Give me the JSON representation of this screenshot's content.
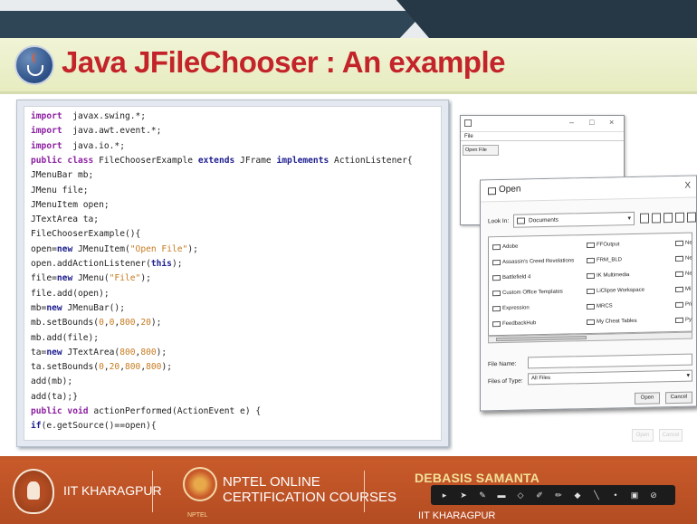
{
  "slide": {
    "title_part1": "Java JFileChooser",
    "title_part2": " : An example"
  },
  "code_lines": [
    [
      [
        "kw",
        "import"
      ],
      [
        "",
        "  javax.swing.*;"
      ]
    ],
    [
      [
        "kw",
        "import"
      ],
      [
        "",
        "  java.awt.event.*;"
      ]
    ],
    [
      [
        "kw",
        "import"
      ],
      [
        "",
        "  java.io.*;"
      ]
    ],
    [
      [
        "kw",
        "public class"
      ],
      [
        "",
        " FileChooserExample "
      ],
      [
        "kwb",
        "extends"
      ],
      [
        "",
        " JFrame "
      ],
      [
        "kwb",
        "implements"
      ],
      [
        "",
        " ActionListener{"
      ]
    ],
    [
      [
        "",
        "JMenuBar mb;"
      ]
    ],
    [
      [
        "",
        "JMenu file;"
      ]
    ],
    [
      [
        "",
        "JMenuItem open;"
      ]
    ],
    [
      [
        "",
        "JTextArea ta;"
      ]
    ],
    [
      [
        "",
        "FileChooserExample(){"
      ]
    ],
    [
      [
        "",
        "open="
      ],
      [
        "kwb",
        "new"
      ],
      [
        "",
        " JMenuItem("
      ],
      [
        "str",
        "\"Open File\""
      ],
      [
        "",
        ");"
      ]
    ],
    [
      [
        "",
        "open.addActionListener("
      ],
      [
        "kwb",
        "this"
      ],
      [
        "",
        ");"
      ]
    ],
    [
      [
        "",
        "file="
      ],
      [
        "kwb",
        "new"
      ],
      [
        "",
        " JMenu("
      ],
      [
        "str",
        "\"File\""
      ],
      [
        "",
        ");"
      ]
    ],
    [
      [
        "",
        "file.add(open);"
      ]
    ],
    [
      [
        "",
        "mb="
      ],
      [
        "kwb",
        "new"
      ],
      [
        "",
        " JMenuBar();"
      ]
    ],
    [
      [
        "",
        "mb.setBounds("
      ],
      [
        "num",
        "0"
      ],
      [
        "",
        ","
      ],
      [
        "num",
        "0"
      ],
      [
        "",
        ","
      ],
      [
        "num",
        "800"
      ],
      [
        "",
        ","
      ],
      [
        "num",
        "20"
      ],
      [
        "",
        ");"
      ]
    ],
    [
      [
        "",
        "mb.add(file);"
      ]
    ],
    [
      [
        "",
        "ta="
      ],
      [
        "kwb",
        "new"
      ],
      [
        "",
        " JTextArea("
      ],
      [
        "num",
        "800"
      ],
      [
        "",
        ","
      ],
      [
        "num",
        "800"
      ],
      [
        "",
        ");"
      ]
    ],
    [
      [
        "",
        "ta.setBounds("
      ],
      [
        "num",
        "0"
      ],
      [
        "",
        ","
      ],
      [
        "num",
        "20"
      ],
      [
        "",
        ","
      ],
      [
        "num",
        "800"
      ],
      [
        "",
        ","
      ],
      [
        "num",
        "800"
      ],
      [
        "",
        ");"
      ]
    ],
    [
      [
        "",
        "add(mb);"
      ]
    ],
    [
      [
        "",
        "add(ta);}"
      ]
    ],
    [
      [
        "kw",
        "public void"
      ],
      [
        "",
        " actionPerformed(ActionEvent e) {"
      ]
    ],
    [
      [
        "kwb",
        "if"
      ],
      [
        "",
        "(e.getSource()==open){"
      ]
    ]
  ],
  "small_window": {
    "controls": [
      "–",
      "□",
      "×"
    ],
    "menu_label": "File",
    "menu_item": "Open File"
  },
  "open_dialog": {
    "title": "Open",
    "close": "X",
    "look_in_label": "Look In:",
    "look_in_value": "Documents",
    "files_col1": [
      "Adobe",
      "Assassin's Creed Revelations",
      "Battlefield 4",
      "Custom Office Templates",
      "Expression",
      "FeedbackHub"
    ],
    "files_col2": [
      "FFOutput",
      "FRM_BLD",
      "IK Multimedia",
      "LiClipse Workspace",
      "MRCS",
      "My Cheat Tables"
    ],
    "files_col3": [
      "Ne",
      "Ne",
      "Ne",
      "Mi",
      "Pri",
      "Pyt"
    ],
    "file_name_label": "File Name:",
    "file_name_value": "",
    "files_of_type_label": "Files of Type:",
    "files_of_type_value": "All Files",
    "open_button": "Open",
    "cancel_button": "Cancel"
  },
  "ghost_buttons": [
    "Open",
    "Cancel"
  ],
  "footer": {
    "institute": "IIT KHARAGPUR",
    "nptel_line1": "NPTEL ONLINE",
    "nptel_line2": "CERTIFICATION COURSES",
    "nptel_sub": "NPTEL",
    "presenter": "DEBASIS SAMANTA",
    "presenter_sub": "IIT KHARAGPUR",
    "toolbar_icons": [
      "pointer-icon",
      "arrow-icon",
      "pen-icon",
      "highlighter-icon",
      "eraser-icon",
      "marker-icon",
      "pencil-icon",
      "brush-icon",
      "line-icon",
      "laser-icon",
      "screen-icon",
      "clear-icon"
    ]
  },
  "colors": {
    "title_red": "#c3242a",
    "footer_orange": "#c2592b",
    "keyword_purple": "#8b1fa0",
    "keyword_blue": "#1d1d8f",
    "string_orange": "#c77b1f"
  }
}
